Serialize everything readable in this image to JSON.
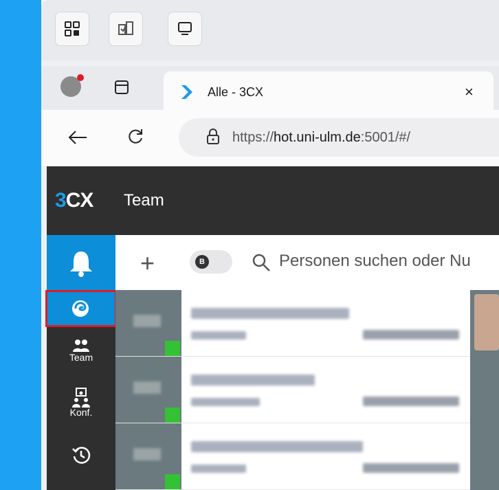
{
  "browser": {
    "tab_title": "Alle - 3CX",
    "tab_close": "×",
    "url_scheme": "https://",
    "url_host": "hot.uni-ulm.de",
    "url_rest": ":5001/#/"
  },
  "app": {
    "logo_three": "3",
    "logo_cx": "CX",
    "title": "Team",
    "search_placeholder": "Personen suchen oder Nu",
    "toggle_letter": "B",
    "nav": [
      {
        "label": "Team"
      },
      {
        "label": "Konf."
      }
    ]
  },
  "colors": {
    "accent": "#0c8ed9",
    "status_online": "#35c135",
    "highlight": "#e01b24"
  }
}
